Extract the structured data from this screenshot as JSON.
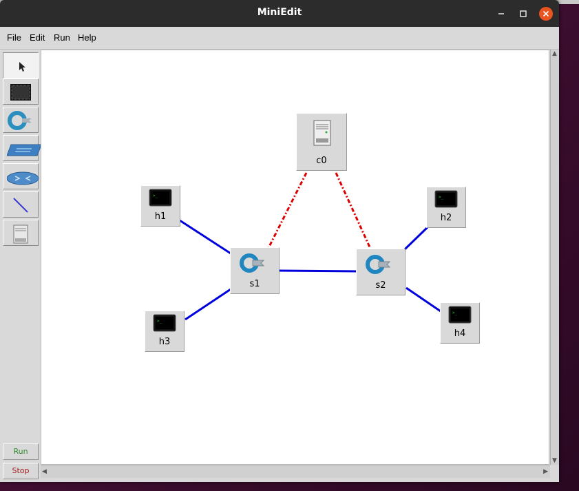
{
  "window": {
    "title": "MiniEdit"
  },
  "menu": [
    "File",
    "Edit",
    "Run",
    "Help"
  ],
  "toolbar": {
    "tools": [
      "select-icon",
      "host-icon",
      "switch-icon",
      "legacy-switch-icon",
      "router-icon",
      "link-icon",
      "controller-icon"
    ],
    "run_label": "Run",
    "stop_label": "Stop"
  },
  "canvas": {
    "nodes": {
      "c0": {
        "label": "c0",
        "kind": "controller"
      },
      "h1": {
        "label": "h1",
        "kind": "host"
      },
      "h2": {
        "label": "h2",
        "kind": "host"
      },
      "h3": {
        "label": "h3",
        "kind": "host"
      },
      "h4": {
        "label": "h4",
        "kind": "host"
      },
      "s1": {
        "label": "s1",
        "kind": "switch"
      },
      "s2": {
        "label": "s2",
        "kind": "switch"
      }
    },
    "links": [
      {
        "from": "h1",
        "to": "s1",
        "type": "data"
      },
      {
        "from": "h3",
        "to": "s1",
        "type": "data"
      },
      {
        "from": "s1",
        "to": "s2",
        "type": "data"
      },
      {
        "from": "s2",
        "to": "h2",
        "type": "data"
      },
      {
        "from": "s2",
        "to": "h4",
        "type": "data"
      },
      {
        "from": "c0",
        "to": "s1",
        "type": "control"
      },
      {
        "from": "c0",
        "to": "s2",
        "type": "control"
      }
    ]
  },
  "colors": {
    "data_link": "#0000dd",
    "control_link": "#dd0000",
    "accent": "#e95420",
    "titlebar": "#2c2c2c"
  }
}
